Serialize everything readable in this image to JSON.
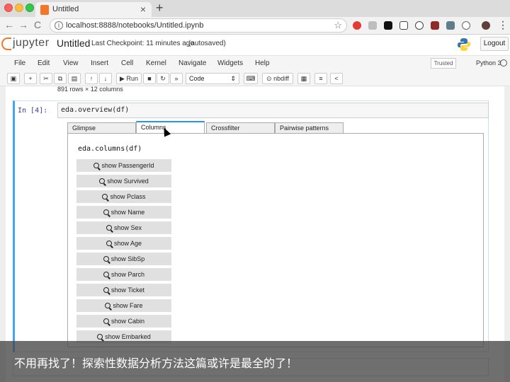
{
  "browser": {
    "tab_title": "Untitled",
    "new_tab": "+",
    "close_glyph": "×",
    "url": "localhost:8888/notebooks/Untitled.ipynb",
    "back": "←",
    "forward": "→",
    "reload": "C",
    "star": "☆"
  },
  "jupyter": {
    "logo_text": "jupyter",
    "notebook_name": "Untitled",
    "checkpoint": "Last Checkpoint: 11 minutes ago",
    "autosave": "(autosaved)",
    "logout": "Logout"
  },
  "menubar": {
    "items": [
      "File",
      "Edit",
      "View",
      "Insert",
      "Cell",
      "Kernel",
      "Navigate",
      "Widgets",
      "Help"
    ],
    "trusted": "Trusted",
    "kernel": "Python 3"
  },
  "toolbar": {
    "run": "Run",
    "cell_type": "Code",
    "nbdiff": "nbdiff"
  },
  "notebook": {
    "prev_output": "891 rows × 12 columns",
    "prompt": "In [4]:",
    "code": "eda.overview(df)",
    "tabs": [
      "Glimpse",
      "Columns",
      "Crossfilter",
      "Pairwise patterns"
    ],
    "active_tab": "Columns",
    "panel_code": "eda.columns(df)",
    "column_buttons": [
      "show PassengerId",
      "show Survived",
      "show Pclass",
      "show Name",
      "show Sex",
      "show Age",
      "show SibSp",
      "show Parch",
      "show Ticket",
      "show Fare",
      "show Cabin",
      "show Embarked"
    ]
  },
  "caption": "不用再找了！探索性数据分析方法这篇或许是最全的了！",
  "colors": {
    "jupyter_orange": "#f37726",
    "selected_cell_border": "#42a5f5",
    "active_tab_border": "#2196f3"
  }
}
